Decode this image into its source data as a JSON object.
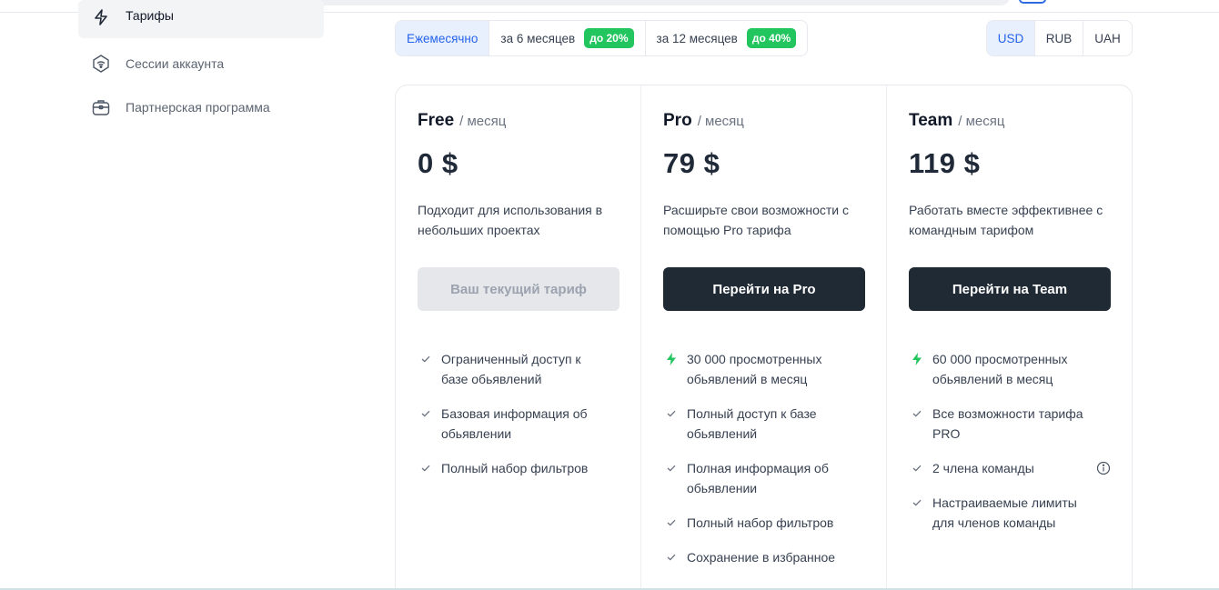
{
  "sidebar": {
    "items": [
      {
        "label": "Тарифы",
        "icon": "lightning-icon",
        "active": true
      },
      {
        "label": "Сессии аккаунта",
        "icon": "wifi-shield-icon",
        "active": false
      },
      {
        "label": "Партнерская программа",
        "icon": "briefcase-icon",
        "active": false
      }
    ]
  },
  "period": {
    "options": [
      {
        "label": "Ежемесячно",
        "badge": null,
        "active": true
      },
      {
        "label": "за 6 месяцев",
        "badge": "до 20%",
        "active": false
      },
      {
        "label": "за 12 месяцев",
        "badge": "до 40%",
        "active": false
      }
    ]
  },
  "currency": {
    "options": [
      {
        "label": "USD",
        "active": true
      },
      {
        "label": "RUB",
        "active": false
      },
      {
        "label": "UAH",
        "active": false
      }
    ]
  },
  "plans": [
    {
      "name": "Free",
      "period": "/ месяц",
      "price": "0 $",
      "description": "Подходит для использования в небольших проектах",
      "button": "Ваш текущий тариф",
      "features": [
        {
          "text": "Ограниченный доступ к базе обьявлений",
          "icon": "check-icon"
        },
        {
          "text": "Базовая информация об обьявлении",
          "icon": "check-icon"
        },
        {
          "text": "Полный набор фильтров",
          "icon": "check-icon"
        }
      ]
    },
    {
      "name": "Pro",
      "period": "/ месяц",
      "price": "79 $",
      "description": "Расширьте свои возможности с помощью Pro тарифа",
      "button": "Перейти на Pro",
      "features": [
        {
          "text": "30 000 просмотренных обьявлений в месяц",
          "icon": "lightning-icon"
        },
        {
          "text": "Полный доступ к базе обьявлений",
          "icon": "check-icon"
        },
        {
          "text": "Полная информация об обьявлении",
          "icon": "check-icon"
        },
        {
          "text": "Полный набор фильтров",
          "icon": "check-icon"
        },
        {
          "text": "Сохранение в избранное",
          "icon": "check-icon"
        }
      ]
    },
    {
      "name": "Team",
      "period": "/ месяц",
      "price": "119 $",
      "description": "Работать вместе эффективнее с командным тарифом",
      "button": "Перейти на Team",
      "features": [
        {
          "text": "60 000 просмотренных обьявлений в месяц",
          "icon": "lightning-icon"
        },
        {
          "text": "Все возможности тарифа PRO",
          "icon": "check-icon"
        },
        {
          "text": "2 члена команды",
          "icon": "check-icon"
        },
        {
          "text": "Настраиваемые лимиты для членов команды",
          "icon": "check-icon"
        }
      ]
    }
  ],
  "colors": {
    "accent": "#2563eb",
    "badge_green": "#22c55e",
    "button_dark": "#1f2a35",
    "bolt_green": "#22c55e"
  }
}
